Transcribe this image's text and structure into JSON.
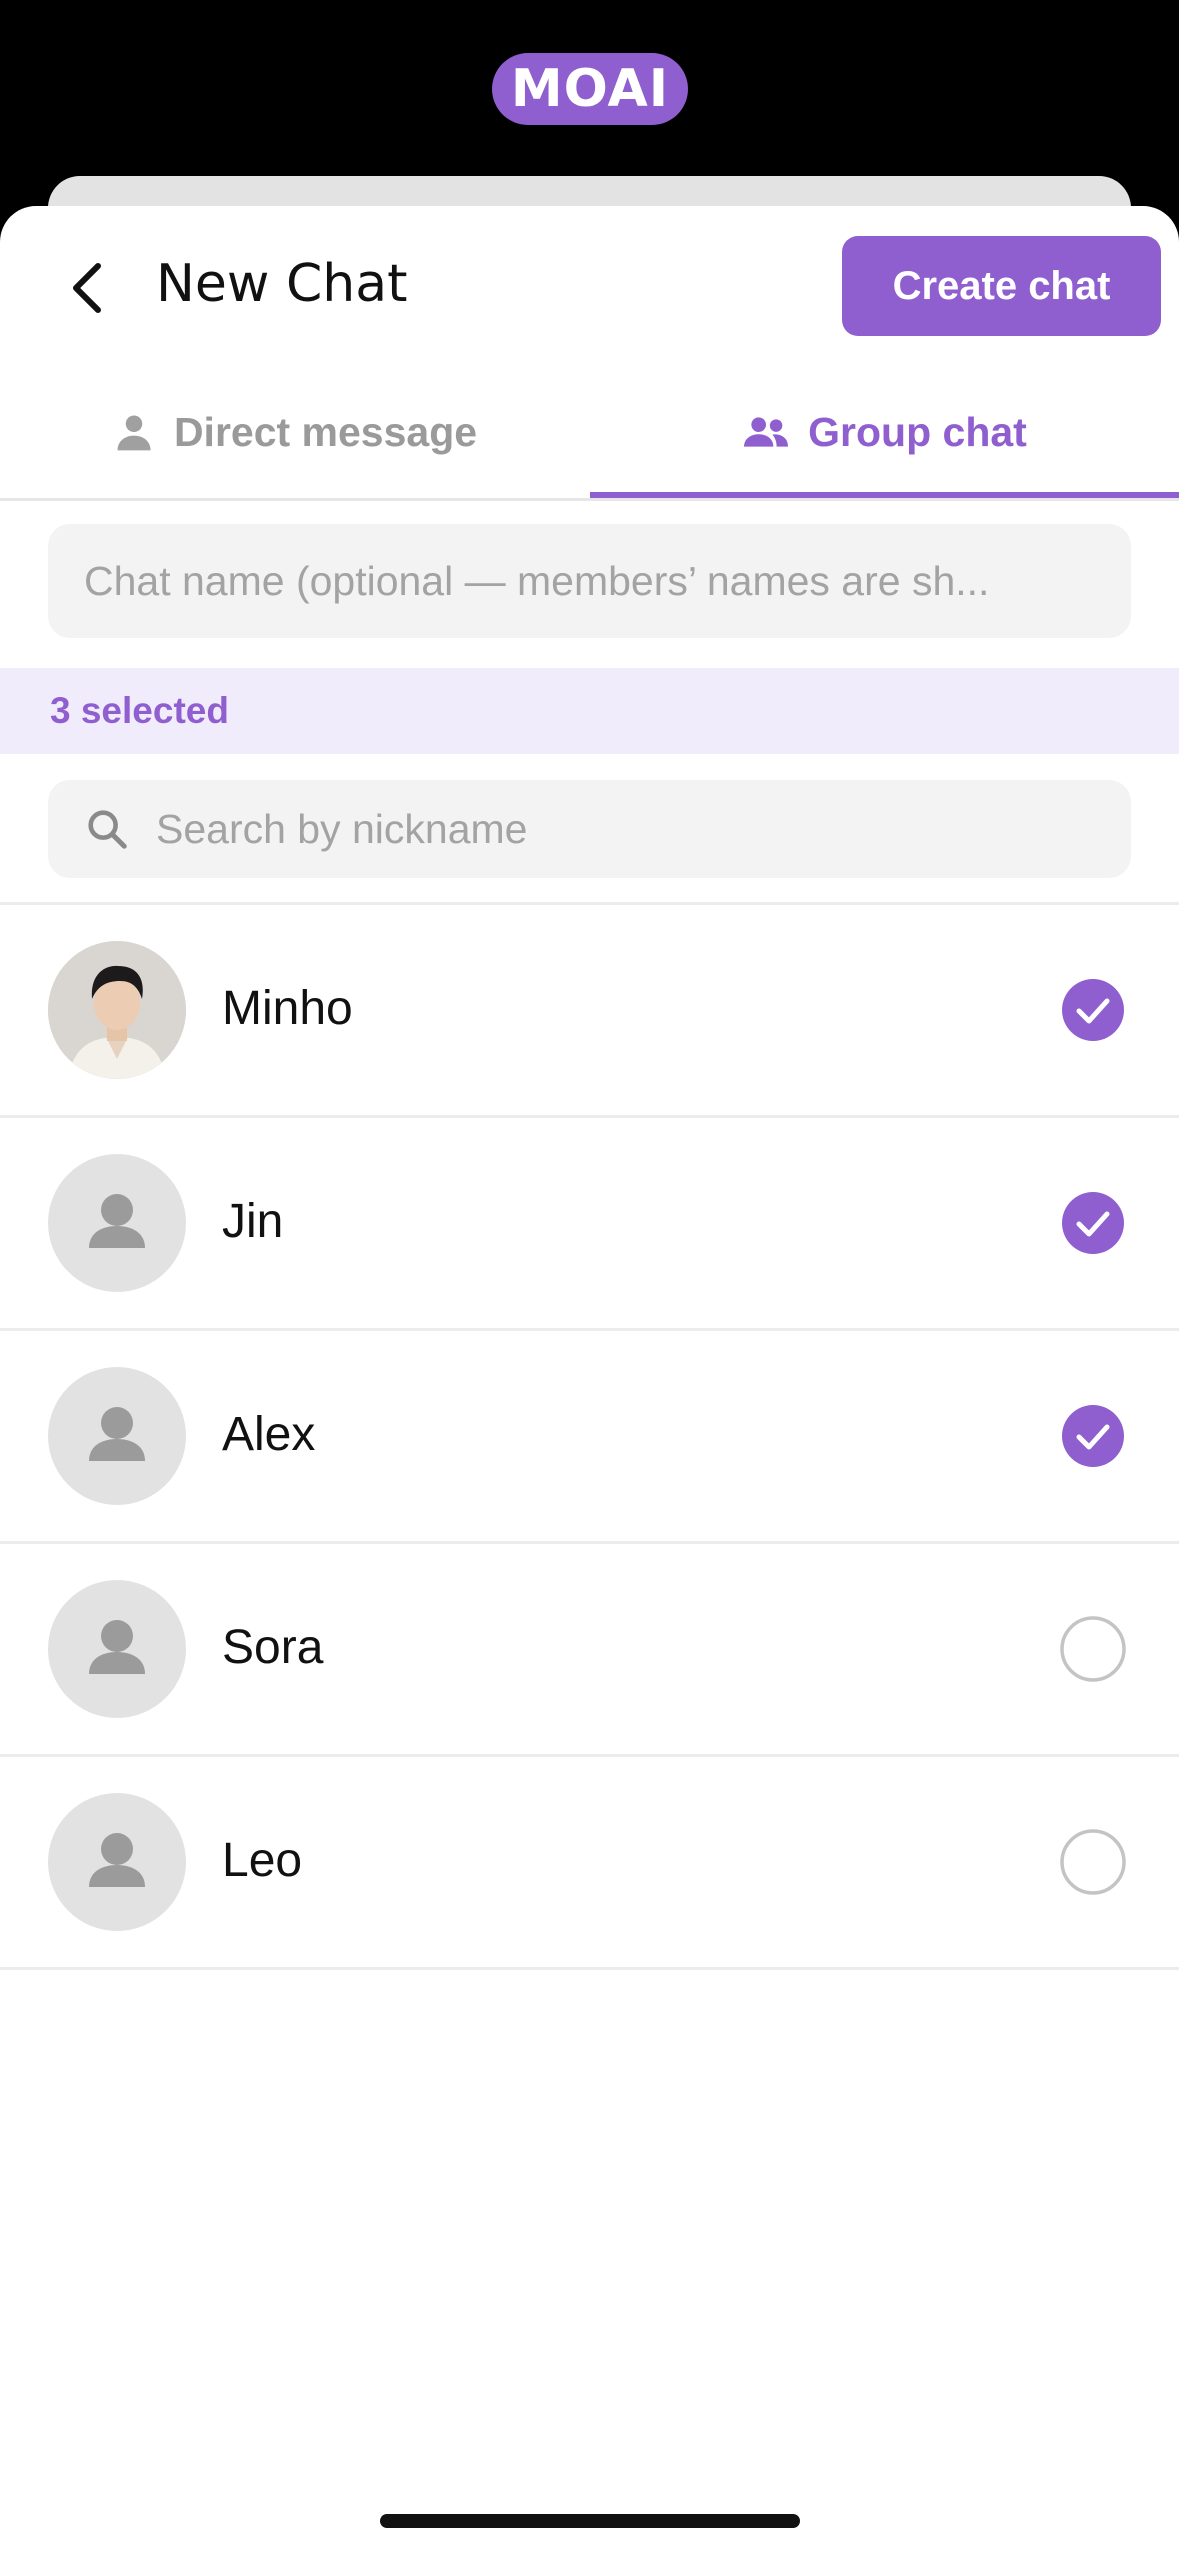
{
  "app": {
    "brand": "MOAI",
    "brand_color": "#8f5fcf"
  },
  "header": {
    "back_icon": "chevron-left-icon",
    "title": "New Chat",
    "create_label": "Create chat"
  },
  "tabs": [
    {
      "label": "Direct message",
      "icon": "person-icon",
      "active": false
    },
    {
      "label": "Group chat",
      "icon": "people-icon",
      "active": true
    }
  ],
  "chat_name": {
    "placeholder": "Chat name (optional — members’ names are sh...",
    "value": ""
  },
  "selected_text": "3 selected",
  "search": {
    "placeholder": "Search by nickname",
    "value": ""
  },
  "contacts": [
    {
      "name": "Minho",
      "selected": true,
      "avatar": "photo"
    },
    {
      "name": "Jin",
      "selected": true,
      "avatar": "default-person-icon"
    },
    {
      "name": "Alex",
      "selected": true,
      "avatar": "default-person-icon"
    },
    {
      "name": "Sora",
      "selected": false,
      "avatar": "default-person-icon"
    },
    {
      "name": "Leo",
      "selected": false,
      "avatar": "default-person-icon"
    }
  ]
}
